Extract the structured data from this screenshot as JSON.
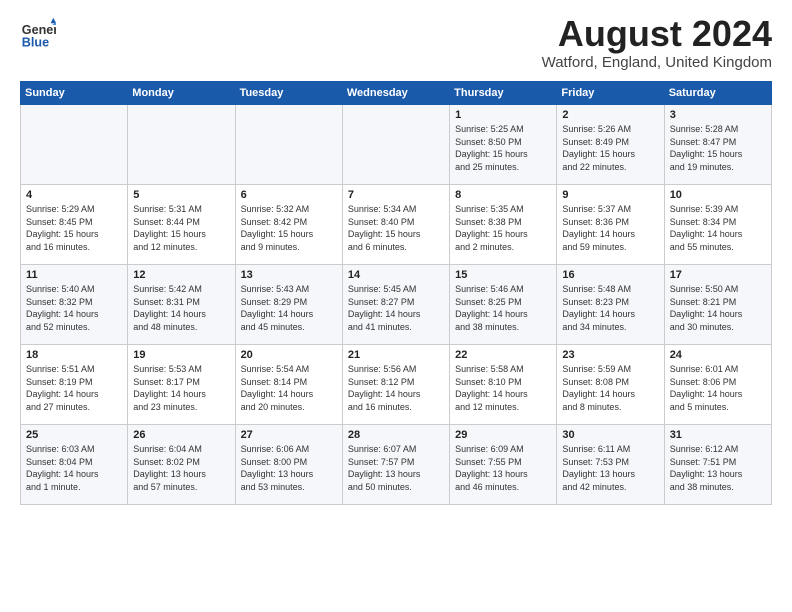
{
  "header": {
    "logo_line1": "General",
    "logo_line2": "Blue",
    "month_year": "August 2024",
    "location": "Watford, England, United Kingdom"
  },
  "weekdays": [
    "Sunday",
    "Monday",
    "Tuesday",
    "Wednesday",
    "Thursday",
    "Friday",
    "Saturday"
  ],
  "weeks": [
    [
      {
        "day": "",
        "info": ""
      },
      {
        "day": "",
        "info": ""
      },
      {
        "day": "",
        "info": ""
      },
      {
        "day": "",
        "info": ""
      },
      {
        "day": "1",
        "info": "Sunrise: 5:25 AM\nSunset: 8:50 PM\nDaylight: 15 hours\nand 25 minutes."
      },
      {
        "day": "2",
        "info": "Sunrise: 5:26 AM\nSunset: 8:49 PM\nDaylight: 15 hours\nand 22 minutes."
      },
      {
        "day": "3",
        "info": "Sunrise: 5:28 AM\nSunset: 8:47 PM\nDaylight: 15 hours\nand 19 minutes."
      }
    ],
    [
      {
        "day": "4",
        "info": "Sunrise: 5:29 AM\nSunset: 8:45 PM\nDaylight: 15 hours\nand 16 minutes."
      },
      {
        "day": "5",
        "info": "Sunrise: 5:31 AM\nSunset: 8:44 PM\nDaylight: 15 hours\nand 12 minutes."
      },
      {
        "day": "6",
        "info": "Sunrise: 5:32 AM\nSunset: 8:42 PM\nDaylight: 15 hours\nand 9 minutes."
      },
      {
        "day": "7",
        "info": "Sunrise: 5:34 AM\nSunset: 8:40 PM\nDaylight: 15 hours\nand 6 minutes."
      },
      {
        "day": "8",
        "info": "Sunrise: 5:35 AM\nSunset: 8:38 PM\nDaylight: 15 hours\nand 2 minutes."
      },
      {
        "day": "9",
        "info": "Sunrise: 5:37 AM\nSunset: 8:36 PM\nDaylight: 14 hours\nand 59 minutes."
      },
      {
        "day": "10",
        "info": "Sunrise: 5:39 AM\nSunset: 8:34 PM\nDaylight: 14 hours\nand 55 minutes."
      }
    ],
    [
      {
        "day": "11",
        "info": "Sunrise: 5:40 AM\nSunset: 8:32 PM\nDaylight: 14 hours\nand 52 minutes."
      },
      {
        "day": "12",
        "info": "Sunrise: 5:42 AM\nSunset: 8:31 PM\nDaylight: 14 hours\nand 48 minutes."
      },
      {
        "day": "13",
        "info": "Sunrise: 5:43 AM\nSunset: 8:29 PM\nDaylight: 14 hours\nand 45 minutes."
      },
      {
        "day": "14",
        "info": "Sunrise: 5:45 AM\nSunset: 8:27 PM\nDaylight: 14 hours\nand 41 minutes."
      },
      {
        "day": "15",
        "info": "Sunrise: 5:46 AM\nSunset: 8:25 PM\nDaylight: 14 hours\nand 38 minutes."
      },
      {
        "day": "16",
        "info": "Sunrise: 5:48 AM\nSunset: 8:23 PM\nDaylight: 14 hours\nand 34 minutes."
      },
      {
        "day": "17",
        "info": "Sunrise: 5:50 AM\nSunset: 8:21 PM\nDaylight: 14 hours\nand 30 minutes."
      }
    ],
    [
      {
        "day": "18",
        "info": "Sunrise: 5:51 AM\nSunset: 8:19 PM\nDaylight: 14 hours\nand 27 minutes."
      },
      {
        "day": "19",
        "info": "Sunrise: 5:53 AM\nSunset: 8:17 PM\nDaylight: 14 hours\nand 23 minutes."
      },
      {
        "day": "20",
        "info": "Sunrise: 5:54 AM\nSunset: 8:14 PM\nDaylight: 14 hours\nand 20 minutes."
      },
      {
        "day": "21",
        "info": "Sunrise: 5:56 AM\nSunset: 8:12 PM\nDaylight: 14 hours\nand 16 minutes."
      },
      {
        "day": "22",
        "info": "Sunrise: 5:58 AM\nSunset: 8:10 PM\nDaylight: 14 hours\nand 12 minutes."
      },
      {
        "day": "23",
        "info": "Sunrise: 5:59 AM\nSunset: 8:08 PM\nDaylight: 14 hours\nand 8 minutes."
      },
      {
        "day": "24",
        "info": "Sunrise: 6:01 AM\nSunset: 8:06 PM\nDaylight: 14 hours\nand 5 minutes."
      }
    ],
    [
      {
        "day": "25",
        "info": "Sunrise: 6:03 AM\nSunset: 8:04 PM\nDaylight: 14 hours\nand 1 minute."
      },
      {
        "day": "26",
        "info": "Sunrise: 6:04 AM\nSunset: 8:02 PM\nDaylight: 13 hours\nand 57 minutes."
      },
      {
        "day": "27",
        "info": "Sunrise: 6:06 AM\nSunset: 8:00 PM\nDaylight: 13 hours\nand 53 minutes."
      },
      {
        "day": "28",
        "info": "Sunrise: 6:07 AM\nSunset: 7:57 PM\nDaylight: 13 hours\nand 50 minutes."
      },
      {
        "day": "29",
        "info": "Sunrise: 6:09 AM\nSunset: 7:55 PM\nDaylight: 13 hours\nand 46 minutes."
      },
      {
        "day": "30",
        "info": "Sunrise: 6:11 AM\nSunset: 7:53 PM\nDaylight: 13 hours\nand 42 minutes."
      },
      {
        "day": "31",
        "info": "Sunrise: 6:12 AM\nSunset: 7:51 PM\nDaylight: 13 hours\nand 38 minutes."
      }
    ]
  ]
}
